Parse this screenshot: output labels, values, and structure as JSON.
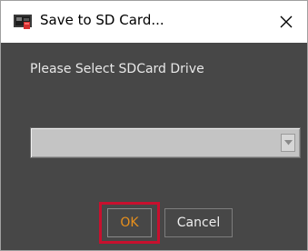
{
  "dialog": {
    "title": "Save to SD Card...",
    "app_icon": "sd-card-app-icon",
    "close_glyph": "✕"
  },
  "prompt": {
    "label": "Please Select SDCard Drive"
  },
  "drive_select": {
    "value": "",
    "arrow_icon": "chevron-down-icon"
  },
  "buttons": {
    "ok_label": "OK",
    "cancel_label": "Cancel"
  },
  "colors": {
    "body_background": "#474747",
    "ok_text": "#e8901c",
    "highlight_border": "#c8102e"
  }
}
